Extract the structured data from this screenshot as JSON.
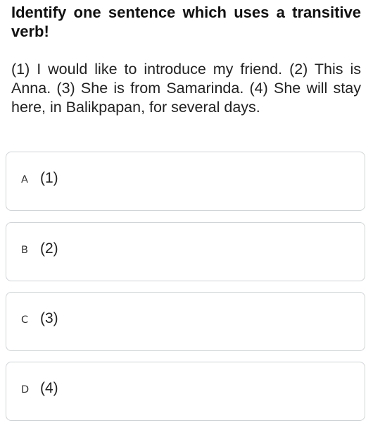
{
  "question": {
    "prompt": "Identify one sentence which uses a transitive verb!",
    "passage": "(1) I would like to introduce my friend.  (2) This is Anna. (3) She is from Samarinda. (4) She will stay here, in Balikpapan, for several days."
  },
  "options": [
    {
      "letter": "A",
      "text": "(1)"
    },
    {
      "letter": "B",
      "text": "(2)"
    },
    {
      "letter": "C",
      "text": "(3)"
    },
    {
      "letter": "D",
      "text": "(4)"
    }
  ]
}
